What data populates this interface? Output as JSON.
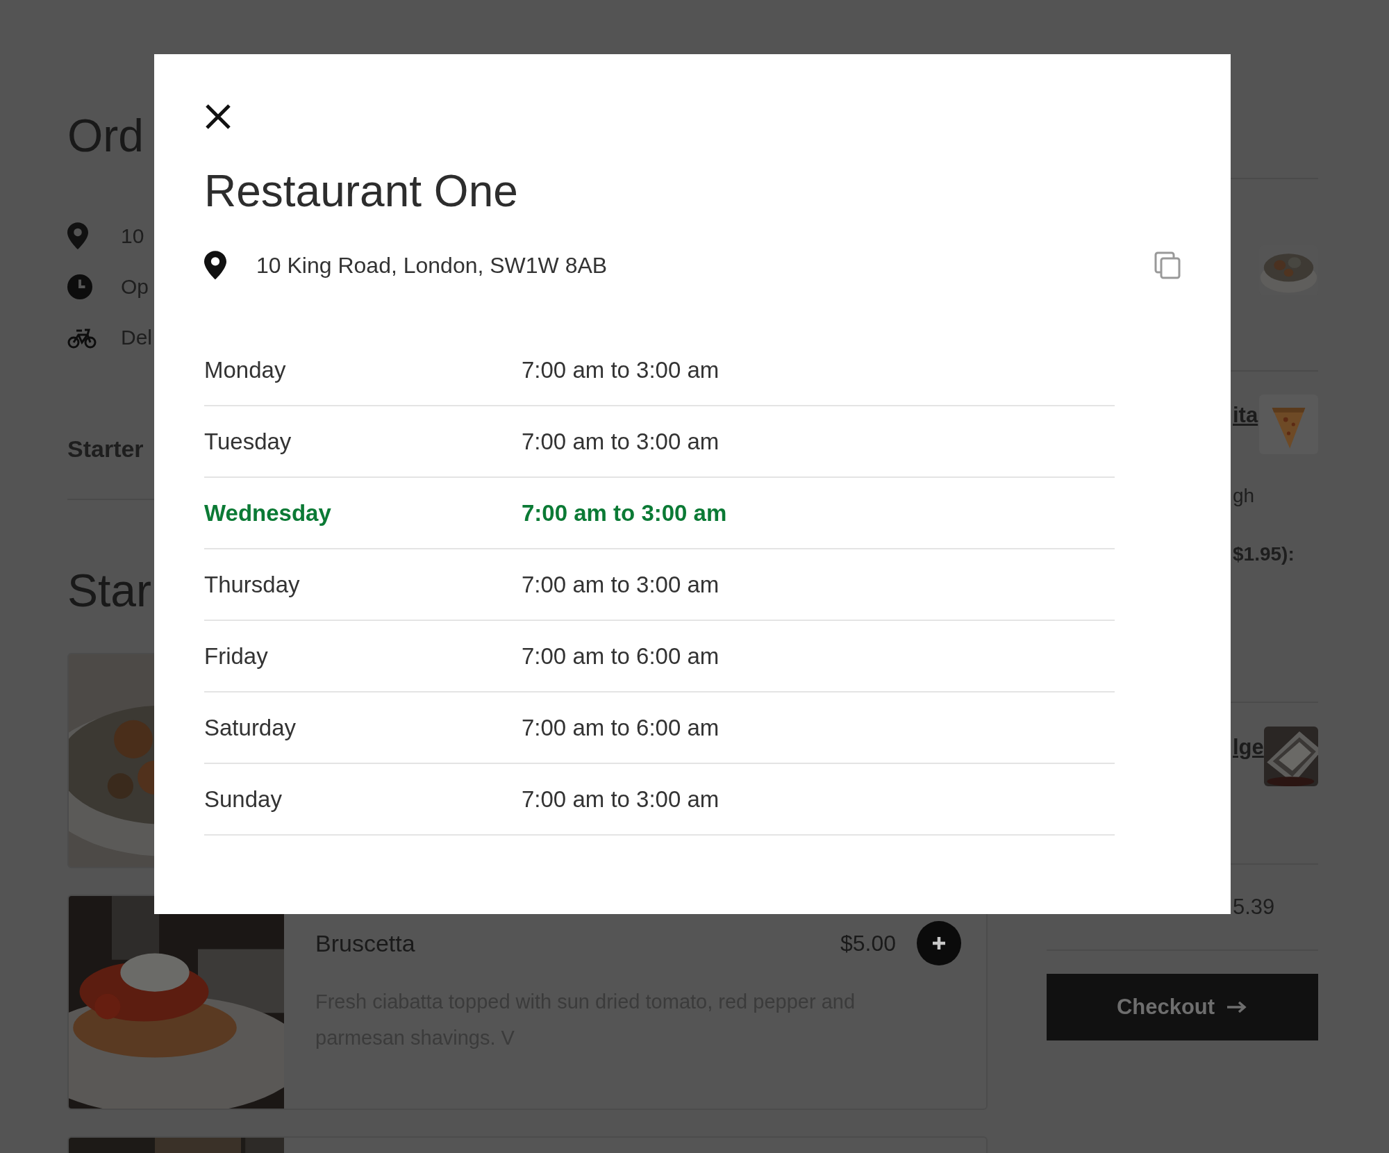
{
  "background": {
    "page_title": "Ord",
    "info": [
      {
        "kind": "location",
        "text": "10"
      },
      {
        "kind": "hours",
        "text": "Op"
      },
      {
        "kind": "delivery",
        "text": "Del"
      }
    ],
    "category_tab": "Starter",
    "section_title": "Star",
    "menu_items": [
      {
        "kind": "photo_only"
      },
      {
        "kind": "full",
        "name": "Bruscetta",
        "price": "$5.00",
        "description": "Fresh ciabatta topped with sun dried tomato, red pepper and parmesan shavings. V"
      },
      {
        "kind": "photo_only"
      }
    ],
    "cart": {
      "items": [
        {
          "kind": "thumb_only"
        },
        {
          "kind": "line",
          "name": "ita",
          "note": "gh",
          "extra": "$1.95):"
        },
        {
          "kind": "line",
          "name": "lge"
        }
      ],
      "subtotal": "5.39",
      "checkout": "Checkout"
    }
  },
  "modal": {
    "title": "Restaurant One",
    "address": "10 King Road, London, SW1W 8AB",
    "hours": [
      {
        "day": "Monday",
        "time": "7:00 am to 3:00 am",
        "selected": false
      },
      {
        "day": "Tuesday",
        "time": "7:00 am to 3:00 am",
        "selected": false
      },
      {
        "day": "Wednesday",
        "time": "7:00 am to 3:00 am",
        "selected": true
      },
      {
        "day": "Thursday",
        "time": "7:00 am to 3:00 am",
        "selected": false
      },
      {
        "day": "Friday",
        "time": "7:00 am to 6:00 am",
        "selected": false
      },
      {
        "day": "Saturday",
        "time": "7:00 am to 6:00 am",
        "selected": false
      },
      {
        "day": "Sunday",
        "time": "7:00 am to 3:00 am",
        "selected": false
      }
    ]
  }
}
